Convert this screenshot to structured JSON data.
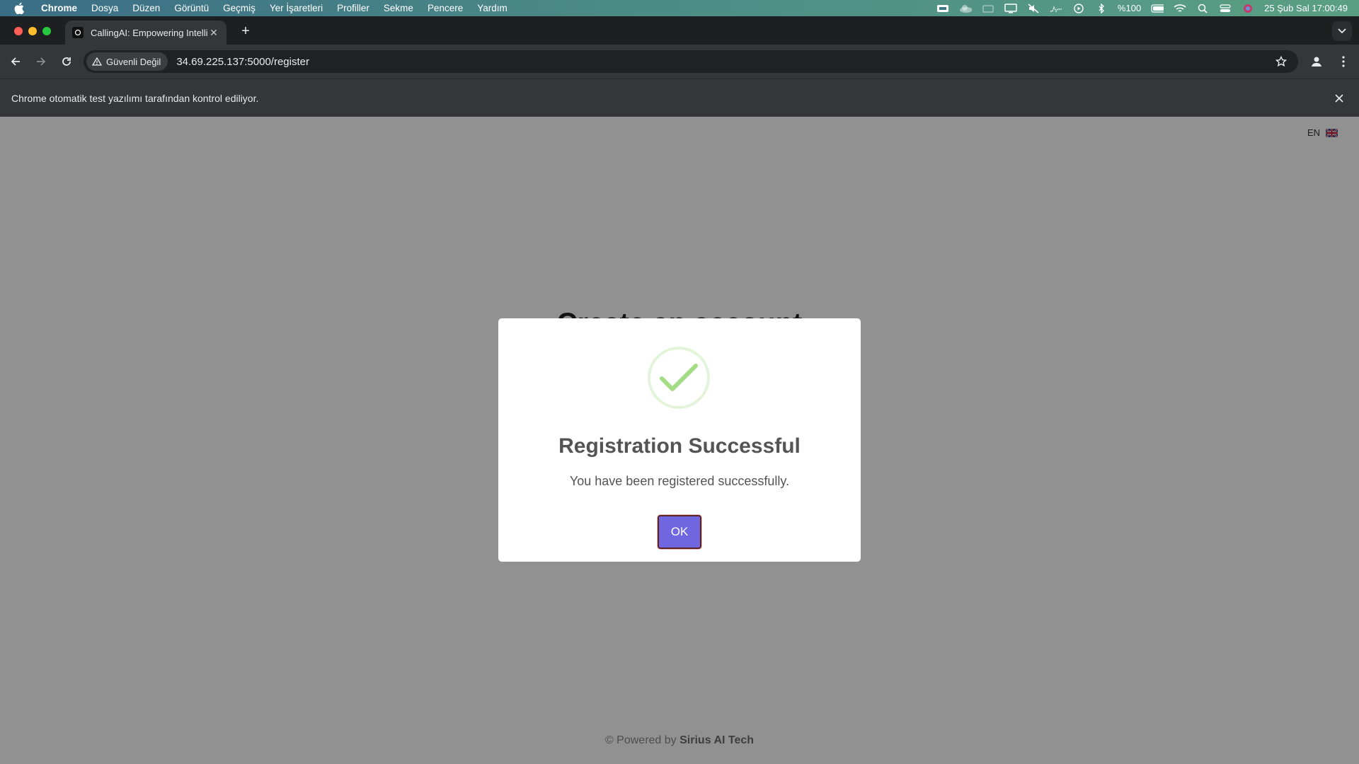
{
  "menubar": {
    "app": "Chrome",
    "items": [
      "Dosya",
      "Düzen",
      "Görüntü",
      "Geçmiş",
      "Yer İşaretleri",
      "Profiller",
      "Sekme",
      "Pencere",
      "Yardım"
    ],
    "battery": "%100",
    "datetime": "25 Şub Sal  17:00:49"
  },
  "tab": {
    "title": "CallingAI: Empowering Intellig"
  },
  "toolbar": {
    "security_label": "Güvenli Değil",
    "url": "34.69.225.137:5000/register"
  },
  "infobar": {
    "message": "Chrome otomatik test yazılımı tarafından kontrol ediliyor."
  },
  "page": {
    "title": "Create an account",
    "language": "EN",
    "footer_prefix": "© Powered by",
    "footer_brand": "Sirius AI Tech"
  },
  "modal": {
    "title": "Registration Successful",
    "text": "You have been registered successfully.",
    "ok_label": "OK"
  },
  "colors": {
    "confirm_button": "#7066e0",
    "success_icon": "#a5dc86",
    "overlay": "rgba(0,0,0,0.43)"
  }
}
